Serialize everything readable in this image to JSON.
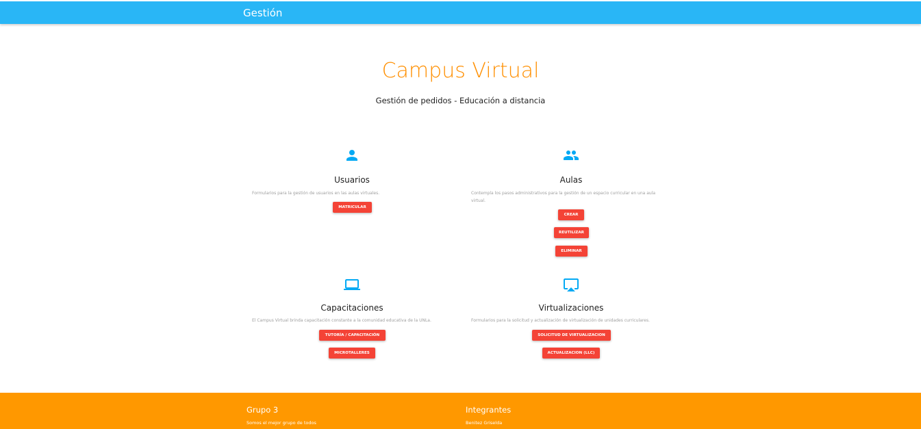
{
  "navbar": {
    "brand": "Gestión"
  },
  "hero": {
    "title": "Campus Virtual",
    "subtitle": "Gestión de pedidos - Educación a distancia"
  },
  "colors": {
    "navbar": "#29b6f6",
    "title": "#ff8f00",
    "icon": "#03a9f4",
    "button": "#f44336",
    "footer": "#ff9800"
  },
  "sections": {
    "usuarios": {
      "icon": "person-icon",
      "title": "Usuarios",
      "description": "Formularios para la gestión de usuarios en las aulas virtuales.",
      "buttons": [
        "MATRICULAR"
      ]
    },
    "aulas": {
      "icon": "people-icon",
      "title": "Aulas",
      "description": "Contempla los pasos administrativos para la gestión de un espacio curricular en una aula virtual.",
      "buttons": [
        "CREAR",
        "REUTILIZAR",
        "ELIMINAR"
      ]
    },
    "capacitaciones": {
      "icon": "laptop-icon",
      "title": "Capacitaciones",
      "description": "El Campus Virtual brinda capacitación constante a la comunidad educativa de la UNLa.",
      "buttons": [
        "TUTORÍA / CAPACITACIÓN",
        "MICROTALLERES"
      ]
    },
    "virtualizaciones": {
      "icon": "airplay-icon",
      "title": "Virtualizaciones",
      "description": "Formularios para la solicitud y actualización de virtualización de unidades curriculares.",
      "buttons": [
        "SOLICITUD DE VIRTUALIZACION",
        "ACTUALIZACION (LLC)"
      ]
    }
  },
  "footer": {
    "group_title": "Grupo 3",
    "group_text": "Somos el mejor grupo de todos",
    "members_title": "Integrantes",
    "members": [
      "Benitez Griselda"
    ]
  }
}
